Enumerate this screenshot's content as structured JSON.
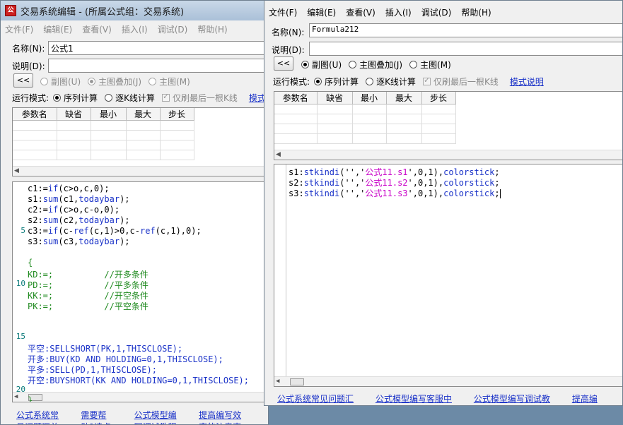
{
  "back": {
    "title": "交易系统编辑 - (所属公式组：交易系统)",
    "menu": [
      "文件(F)",
      "编辑(E)",
      "查看(V)",
      "插入(I)",
      "调试(D)",
      "帮助(H)"
    ],
    "name_label": "名称(N):",
    "name_value": "公式1",
    "desc_label": "说明(D):",
    "desc_value": "",
    "collapse_btn": "<<",
    "chart_opts": [
      "副图(U)",
      "主图叠加(J)",
      "主图(M)"
    ],
    "run_mode_label": "运行模式:",
    "run_opts": [
      "序列计算",
      "逐K线计算"
    ],
    "refresh_label": "仅刷最后一根K线",
    "mode_link": "模式",
    "param_headers": [
      "参数名",
      "缺省",
      "最小",
      "最大",
      "步长"
    ],
    "line_numbers": [
      "5",
      "10",
      "15",
      "20"
    ],
    "code": [
      [
        {
          "t": "c1:="
        },
        {
          "t": "if",
          "c": "kw"
        },
        {
          "t": "(c>o,c,0);"
        }
      ],
      [
        {
          "t": "s1:"
        },
        {
          "t": "sum",
          "c": "kw"
        },
        {
          "t": "(c1,"
        },
        {
          "t": "todaybar",
          "c": "kw"
        },
        {
          "t": ");"
        }
      ],
      [
        {
          "t": "c2:="
        },
        {
          "t": "if",
          "c": "kw"
        },
        {
          "t": "(c>o,c-o,0);"
        }
      ],
      [
        {
          "t": "s2:"
        },
        {
          "t": "sum",
          "c": "kw"
        },
        {
          "t": "(c2,"
        },
        {
          "t": "todaybar",
          "c": "kw"
        },
        {
          "t": ");"
        }
      ],
      [
        {
          "t": "c3:="
        },
        {
          "t": "if",
          "c": "kw"
        },
        {
          "t": "(c-"
        },
        {
          "t": "ref",
          "c": "kw"
        },
        {
          "t": "(c,1)>0,c-"
        },
        {
          "t": "ref",
          "c": "kw"
        },
        {
          "t": "(c,1),0);"
        }
      ],
      [
        {
          "t": "s3:"
        },
        {
          "t": "sum",
          "c": "kw"
        },
        {
          "t": "(c3,"
        },
        {
          "t": "todaybar",
          "c": "kw"
        },
        {
          "t": ");"
        }
      ],
      [],
      [
        {
          "t": "{",
          "c": "cn"
        }
      ],
      [
        {
          "t": "KD:=;          //开多条件",
          "c": "cn"
        }
      ],
      [
        {
          "t": "PD:=;          //平多条件",
          "c": "cn"
        }
      ],
      [
        {
          "t": "KK:=;          //开空条件",
          "c": "cn"
        }
      ],
      [
        {
          "t": "PK:=;          //平空条件",
          "c": "cn"
        }
      ],
      [],
      [],
      [],
      [
        {
          "t": "平空",
          "c": "kw"
        },
        {
          "t": ":SELLSHORT(PK,1,THISCLOSE);",
          "c": "kw"
        }
      ],
      [
        {
          "t": "开多",
          "c": "kw"
        },
        {
          "t": ":BUY(KD AND HOLDING=0,1,THISCLOSE);",
          "c": "kw"
        }
      ],
      [
        {
          "t": "平多",
          "c": "kw"
        },
        {
          "t": ":SELL(PD,1,THISCLOSE);",
          "c": "kw"
        }
      ],
      [
        {
          "t": "开空",
          "c": "kw"
        },
        {
          "t": ":BUYSHORT(KK AND HOLDING=0,1,THISCLOSE);",
          "c": "kw"
        }
      ],
      [],
      [
        {
          "t": "}",
          "c": "cn"
        }
      ]
    ],
    "footer_links": [
      "公式系统常见问题汇总",
      "需要帮助?请点我",
      "公式模型编写调试教程",
      "提高编写效率的注意事项"
    ]
  },
  "front": {
    "menu": [
      "文件(F)",
      "编辑(E)",
      "查看(V)",
      "插入(I)",
      "调试(D)",
      "帮助(H)"
    ],
    "name_label": "名称(N):",
    "name_value": "Formula212",
    "desc_label": "说明(D):",
    "desc_value": "",
    "collapse_btn": "<<",
    "chart_opts": [
      "副图(U)",
      "主图叠加(J)",
      "主图(M)"
    ],
    "run_mode_label": "运行模式:",
    "run_opts": [
      "序列计算",
      "逐K线计算"
    ],
    "refresh_label": "仅刷最后一根K线",
    "mode_link": "模式说明",
    "param_headers": [
      "参数名",
      "缺省",
      "最小",
      "最大",
      "步长"
    ],
    "code": [
      [
        {
          "t": "s1:"
        },
        {
          "t": "stkindi",
          "c": "kw"
        },
        {
          "t": "('','"
        },
        {
          "t": "公式11.s1",
          "c": "str"
        },
        {
          "t": "',0,1),"
        },
        {
          "t": "colorstick",
          "c": "kw"
        },
        {
          "t": ";"
        }
      ],
      [
        {
          "t": "s2:"
        },
        {
          "t": "stkindi",
          "c": "kw"
        },
        {
          "t": "('','"
        },
        {
          "t": "公式11.s2",
          "c": "str"
        },
        {
          "t": "',0,1),"
        },
        {
          "t": "colorstick",
          "c": "kw"
        },
        {
          "t": ";"
        }
      ],
      [
        {
          "t": "s3:"
        },
        {
          "t": "stkindi",
          "c": "kw"
        },
        {
          "t": "('','"
        },
        {
          "t": "公式11.s3",
          "c": "str"
        },
        {
          "t": "',0,1),"
        },
        {
          "t": "colorstick",
          "c": "kw"
        },
        {
          "t": ";"
        }
      ]
    ],
    "footer_links": [
      "公式系统常见问题汇总",
      "公式模型编写客服中心",
      "公式模型编写调试教程",
      "提高编写"
    ]
  }
}
